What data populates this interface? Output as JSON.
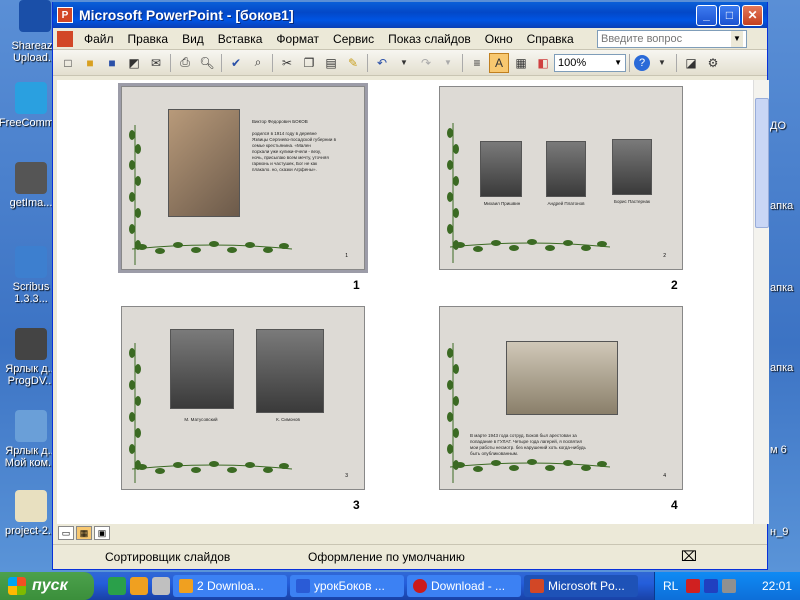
{
  "window": {
    "title": "Microsoft PowerPoint - [боков1]",
    "minimize": "_",
    "maximize": "□",
    "close": "✕"
  },
  "menu": {
    "items": [
      "Файл",
      "Правка",
      "Вид",
      "Вставка",
      "Формат",
      "Сервис",
      "Показ слайдов",
      "Окно",
      "Справка"
    ],
    "ask_placeholder": "Введите вопрос"
  },
  "toolbar": {
    "zoom": "100%"
  },
  "slides": [
    {
      "number": "1",
      "page": "1",
      "text_lines": [
        "Виктор Федорович БОКОВ",
        "",
        "родился в 1914 году в деревне",
        "Язвицы Сергиево-посадской губернии в",
        "семье крестьянина. «Мален",
        "порхали уже кулики-пчели - везу,",
        "ночь, присылаю всем мечту, уточняя",
        "гармонь и частушек, Бог не как",
        "плакало. но, сказки Агрфены»."
      ]
    },
    {
      "number": "2",
      "page": "2",
      "captions": [
        "Михаил Пришвин",
        "Андрей Платонов",
        "Борис Пастернак"
      ]
    },
    {
      "number": "3",
      "page": "3",
      "captions": [
        "М. Матусовский",
        "К. Симонов"
      ]
    },
    {
      "number": "4",
      "page": "4",
      "text_lines": [
        "В марте 1943 года сотруд. Боков был арестован за",
        "попадание в ГУЛАГ. Четыре года лагерей, я посвятил",
        "мои работы несмотр. без нарушений хоть когда-нибудь",
        "быть опубликованным."
      ]
    }
  ],
  "status": {
    "view": "Сортировщик слайдов",
    "design": "Оформление по умолчанию"
  },
  "desktop": {
    "icons": [
      "Shareaza Upload...",
      "FreeComm...",
      "getIma...",
      "Scribus 1.3.3...",
      "Ярлык д... ProgDV...",
      "Ярлык д... Мой ком...",
      "project-2..."
    ],
    "right_labels": [
      "ДО",
      "апка",
      "апка",
      "апка",
      "м 6",
      "н_9"
    ]
  },
  "taskbar": {
    "start": "пуск",
    "tasks": [
      {
        "label": "2 Downloa...",
        "color": "#f0a020"
      },
      {
        "label": "урокБоков ...",
        "color": "#2a5bd6"
      },
      {
        "label": "Download - ...",
        "color": "#cc1a1a"
      },
      {
        "label": "Microsoft Po...",
        "color": "#d24726"
      }
    ],
    "lang": "RL",
    "clock": "22:01"
  }
}
